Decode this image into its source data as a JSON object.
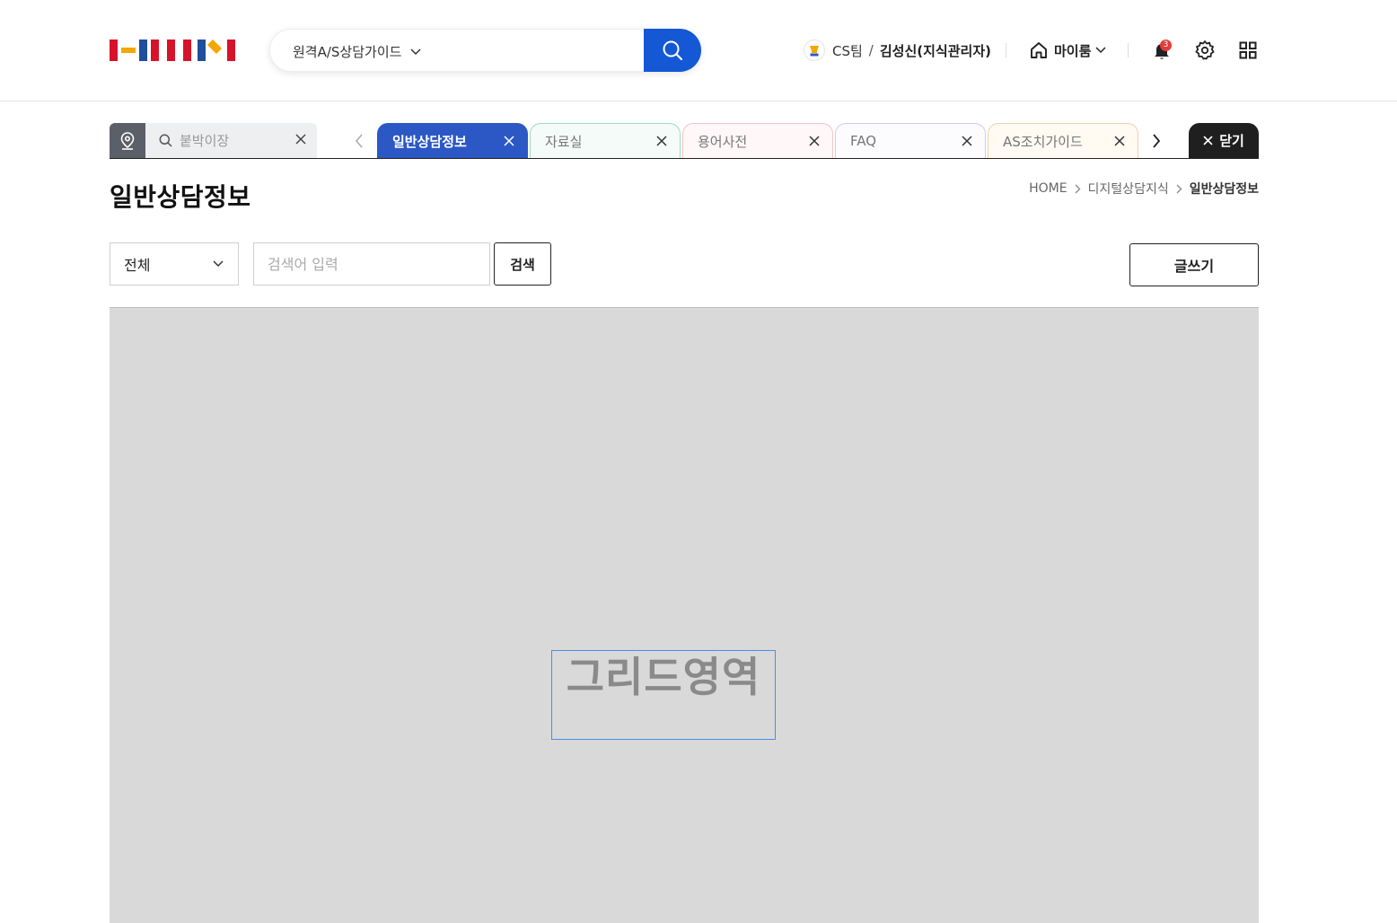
{
  "header": {
    "search_scope": "원격A/S상담가이드",
    "user_team": "CS팀",
    "user_separator": "/",
    "user_name": "김성신(지식관리자)",
    "myroom_label": "마이룸",
    "notification_count": "3"
  },
  "tabs": {
    "pinned_label": "붙박이장",
    "items": [
      {
        "label": "일반상담정보",
        "active": true,
        "color": "#2c58c6"
      },
      {
        "label": "자료실",
        "active": false,
        "color": "#9fd9c8",
        "bg": "#f4fbf8"
      },
      {
        "label": "용어사전",
        "active": false,
        "color": "#f2c5c9",
        "bg": "#fff7f8"
      },
      {
        "label": "FAQ",
        "active": false,
        "color": "#d9c9e8",
        "bg": "#fcfbfe"
      },
      {
        "label": "AS조치가이드",
        "active": false,
        "color": "#f0d3a8",
        "bg": "#fffaf2"
      }
    ],
    "close_all_label": "닫기"
  },
  "page": {
    "title": "일반상담정보",
    "breadcrumb": [
      "HOME",
      "디지털상담지식",
      "일반상담정보"
    ]
  },
  "search": {
    "filter_value": "전체",
    "keyword_placeholder": "검색어 입력",
    "search_button": "검색",
    "write_button": "글쓰기"
  },
  "grid": {
    "placeholder_label": "그리드영역"
  },
  "colors": {
    "primary": "#1558d6",
    "active_tab": "#2c58c6",
    "dark": "#1f1f1f",
    "grid_bg": "#d9d9d9",
    "alert": "#e33a3a"
  }
}
